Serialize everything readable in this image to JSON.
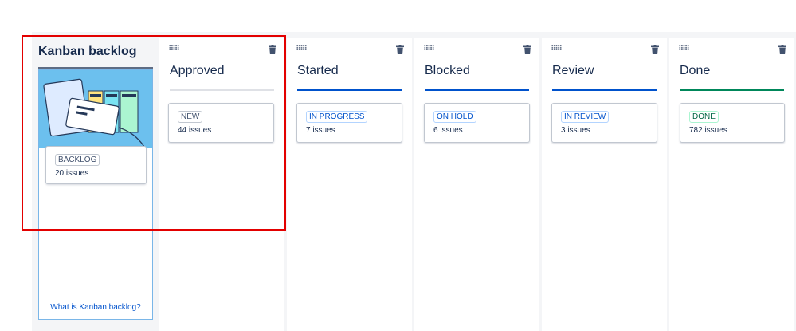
{
  "backlog": {
    "title": "Kanban backlog",
    "status": {
      "label": "BACKLOG",
      "count": "20 issues"
    },
    "help_link": "What is Kanban backlog?"
  },
  "columns": [
    {
      "title": "Approved",
      "status_label": "NEW",
      "count": "44 issues",
      "bar_color": "#dfe1e6",
      "lozenge_color": "#42526e",
      "lozenge_border": "#c1c7d0"
    },
    {
      "title": "Started",
      "status_label": "IN PROGRESS",
      "count": "7 issues",
      "bar_color": "#0052cc",
      "lozenge_color": "#0052cc",
      "lozenge_border": "#b3d4ff"
    },
    {
      "title": "Blocked",
      "status_label": "ON HOLD",
      "count": "6 issues",
      "bar_color": "#0052cc",
      "lozenge_color": "#0052cc",
      "lozenge_border": "#b3d4ff"
    },
    {
      "title": "Review",
      "status_label": "IN REVIEW",
      "count": "3 issues",
      "bar_color": "#0052cc",
      "lozenge_color": "#0052cc",
      "lozenge_border": "#b3d4ff"
    },
    {
      "title": "Done",
      "status_label": "DONE",
      "count": "782 issues",
      "bar_color": "#00875a",
      "lozenge_color": "#006644",
      "lozenge_border": "#abf5d1"
    }
  ],
  "icons": {
    "drag": "drag-handle-icon",
    "delete": "trash-icon"
  },
  "highlight_color": "#e30000"
}
